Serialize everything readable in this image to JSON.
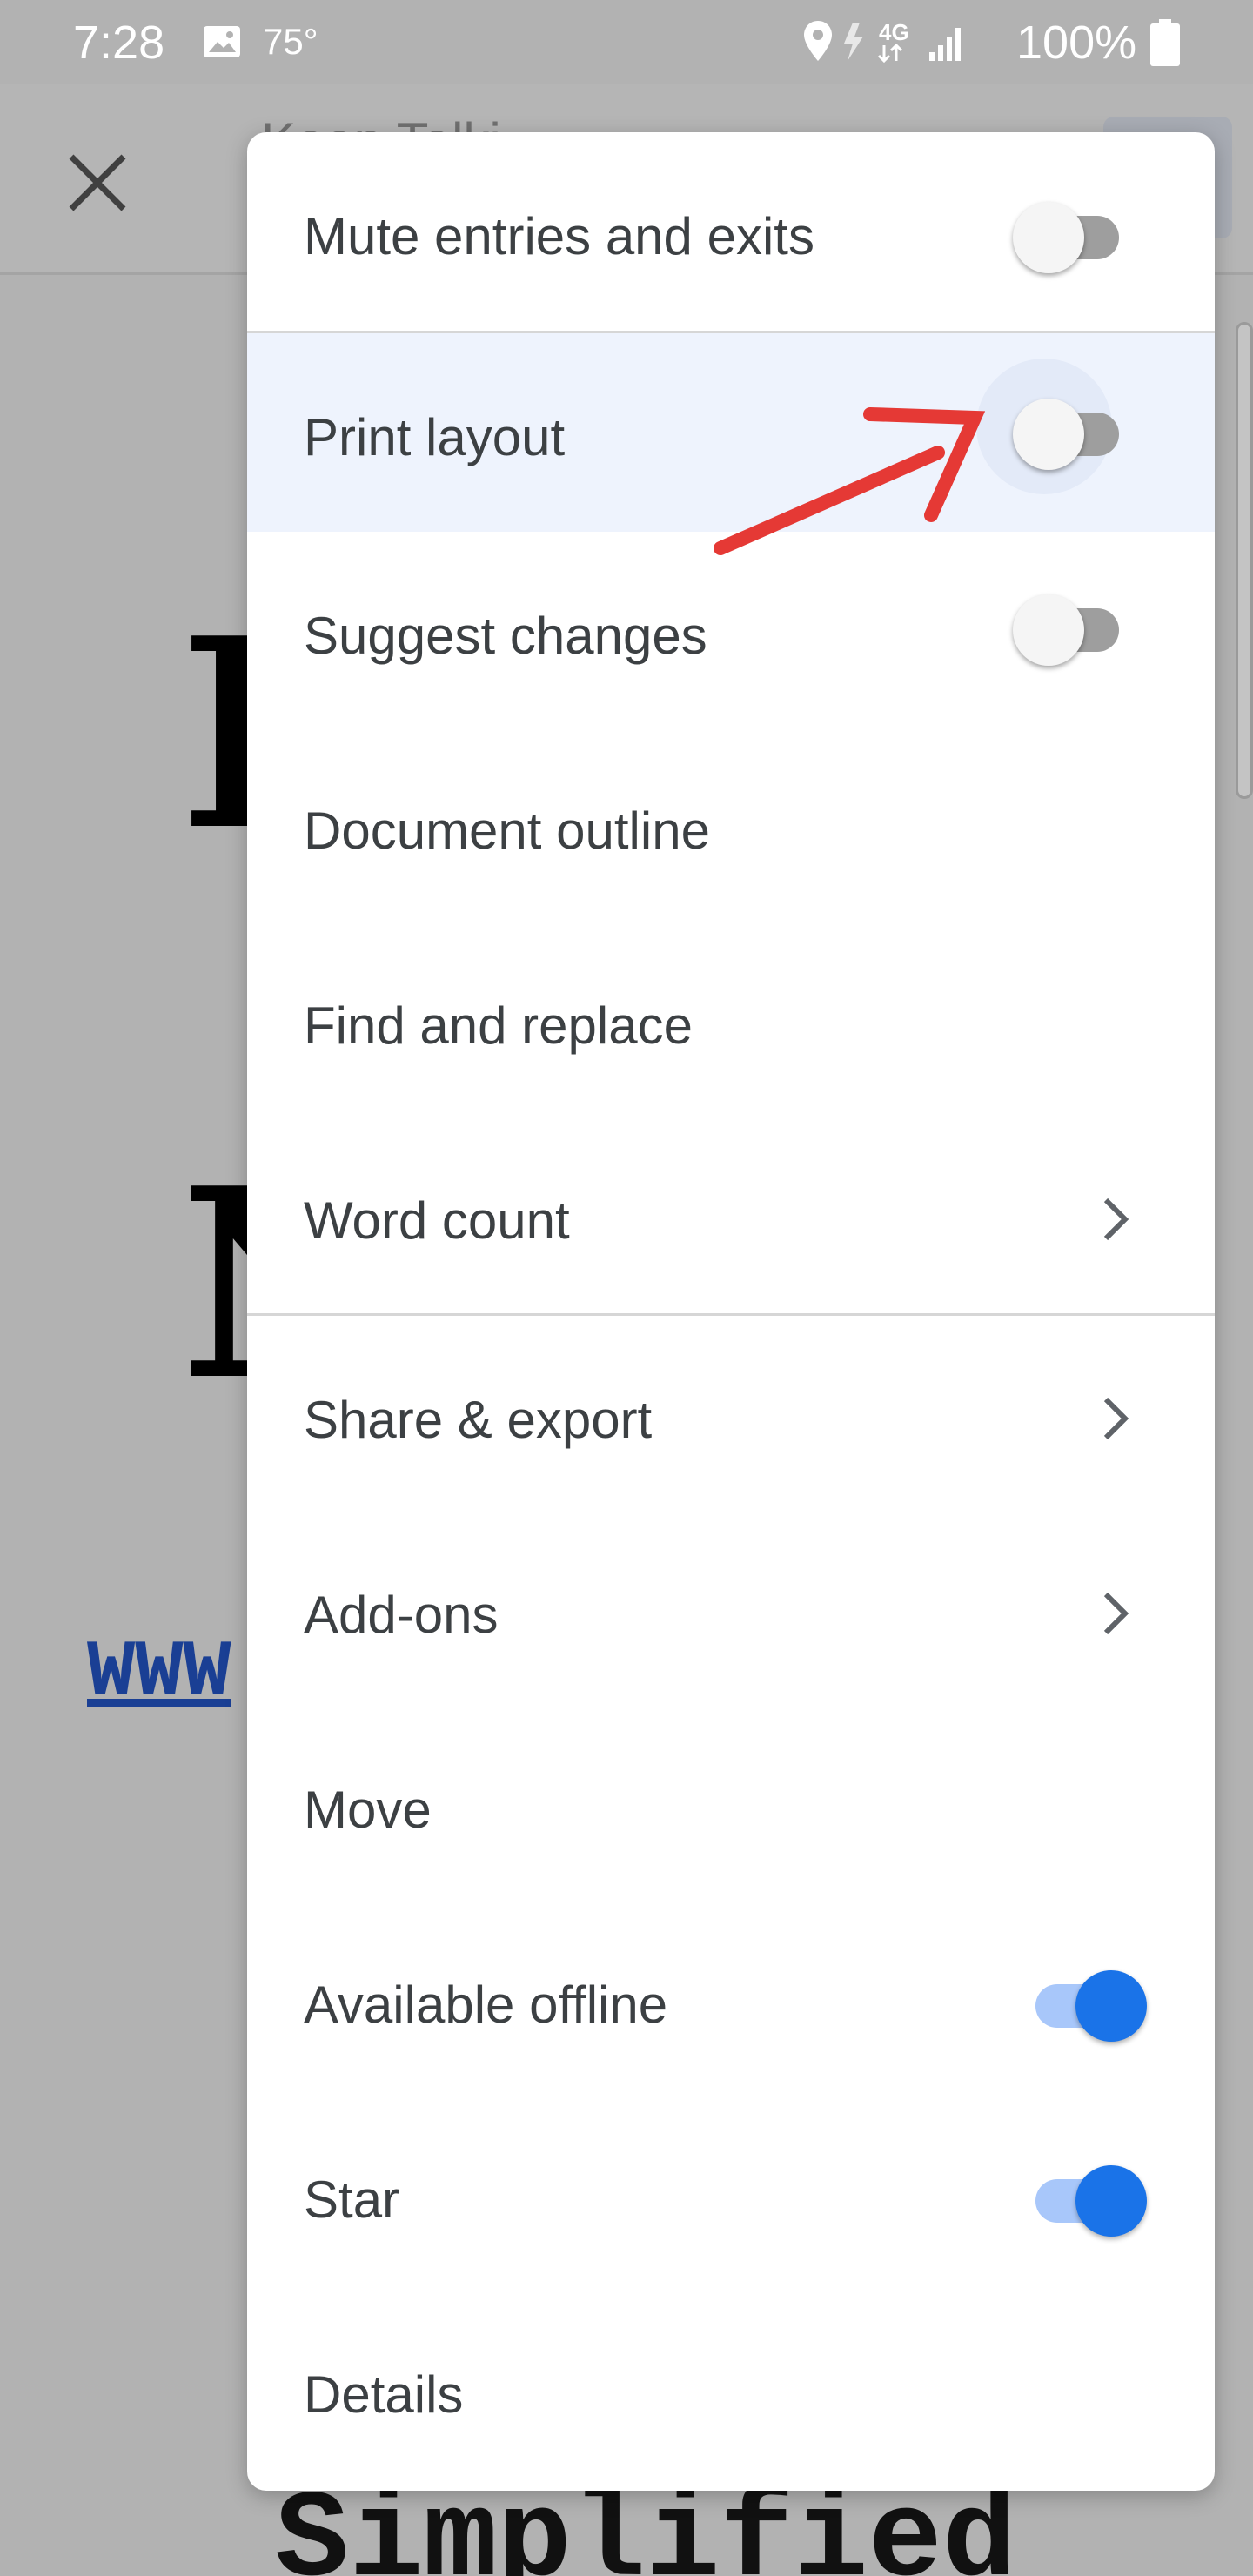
{
  "status_bar": {
    "time": "7:28",
    "temperature": "75°",
    "battery": "100%",
    "icons": [
      "image-icon",
      "location-icon",
      "charging-icon",
      "lte-icon",
      "signal-icon",
      "battery-icon"
    ]
  },
  "doc": {
    "title_fragment": "Keep Talki",
    "link_fragment": "WWW",
    "bottom_text": "Simplified",
    "letters": [
      "I",
      "N"
    ]
  },
  "menu": {
    "items": [
      {
        "label": "Mute entries and exits",
        "type": "toggle",
        "on": false
      },
      {
        "label": "Print layout",
        "type": "toggle",
        "on": false,
        "highlighted": true
      },
      {
        "label": "Suggest changes",
        "type": "toggle",
        "on": false
      },
      {
        "label": "Document outline",
        "type": "action"
      },
      {
        "label": "Find and replace",
        "type": "action"
      },
      {
        "label": "Word count",
        "type": "submenu"
      },
      {
        "label": "Share & export",
        "type": "submenu"
      },
      {
        "label": "Add-ons",
        "type": "submenu"
      },
      {
        "label": "Move",
        "type": "action"
      },
      {
        "label": "Available offline",
        "type": "toggle",
        "on": true
      },
      {
        "label": "Star",
        "type": "toggle",
        "on": true
      },
      {
        "label": "Details",
        "type": "action"
      }
    ]
  },
  "colors": {
    "accent": "#1a73e8",
    "toggle_on_track": "#a8c7fa",
    "highlight": "#eef3fd",
    "annotation_arrow": "#e53935"
  }
}
